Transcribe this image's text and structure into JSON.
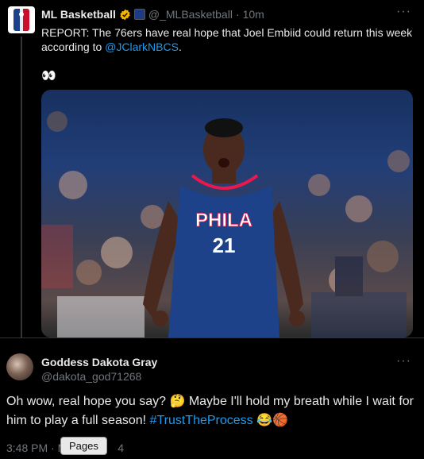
{
  "tweet1": {
    "name": "ML Basketball",
    "handle": "@_MLBasketball",
    "time": "10m",
    "text_before": "REPORT: The 76ers have real hope that Joel Embiid could return this week according to ",
    "mention": "@JClarkNBCS",
    "text_after": ".",
    "emoji": "👀",
    "photo": {
      "jersey_team": "PHILA",
      "jersey_number": "21",
      "team_colors": [
        "#1d428a",
        "#ed174c"
      ]
    }
  },
  "tweet2": {
    "name": "Goddess Dakota Gray",
    "handle": "@dakota_god71268",
    "text": "Oh wow, real hope you say? 🤔 Maybe I'll hold my breath while I wait for him to play a full season! ",
    "hashtag": "#TrustTheProcess",
    "emoji_end": "😂🏀",
    "time_prefix": "3:48 PM · M",
    "time_suffix": "4"
  },
  "tooltip": "Pages",
  "more_label": "···",
  "colors": {
    "link": "#1d9bf0",
    "verified": "#f4b400",
    "background": "#000000"
  }
}
